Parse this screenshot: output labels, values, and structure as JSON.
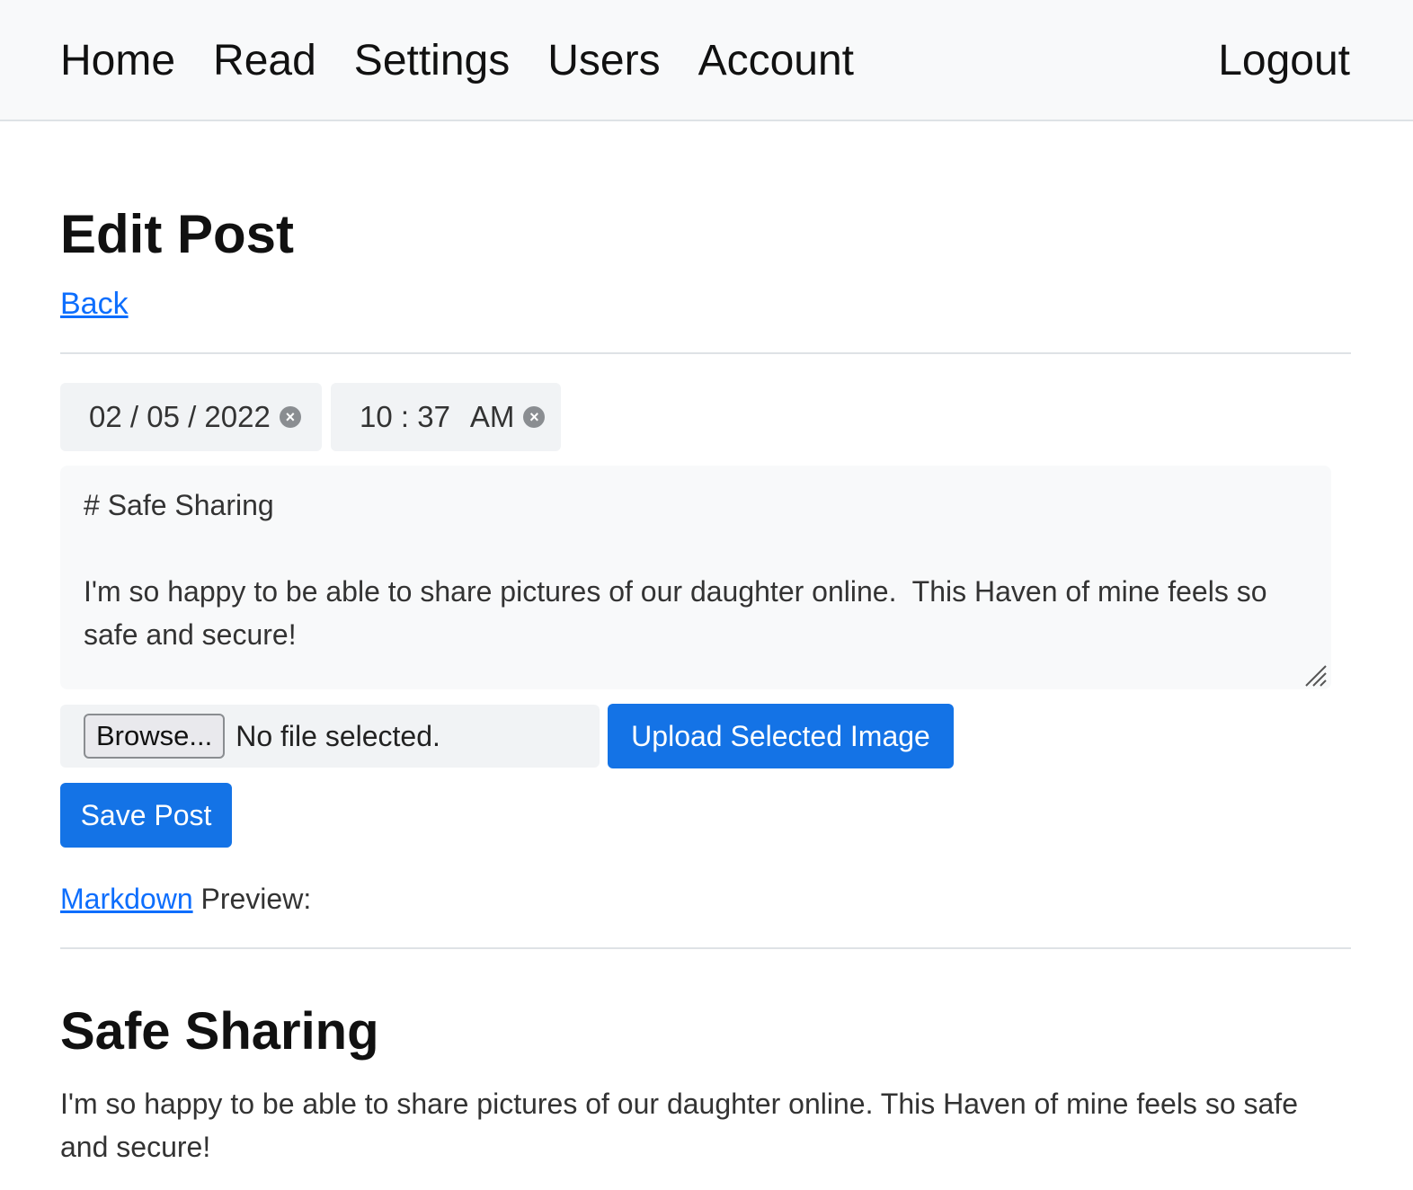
{
  "nav": {
    "items": [
      {
        "label": "Home"
      },
      {
        "label": "Read"
      },
      {
        "label": "Settings"
      },
      {
        "label": "Users"
      },
      {
        "label": "Account"
      }
    ],
    "logout_label": "Logout"
  },
  "page": {
    "title": "Edit Post",
    "back_label": "Back"
  },
  "form": {
    "date_value": "02 / 05 / 2022",
    "time_value": "10 : 37",
    "time_period": "AM",
    "clear_icon": "clear-circle-icon",
    "body_text": "# Safe Sharing\n\nI'm so happy to be able to share pictures of our daughter online.  This Haven of mine feels so safe and secure!",
    "browse_label": "Browse...",
    "file_status": "No file selected.",
    "upload_label": "Upload Selected Image",
    "save_label": "Save Post"
  },
  "preview": {
    "markdown_link": "Markdown",
    "label_suffix": " Preview:",
    "heading": "Safe Sharing",
    "body": "I'm so happy to be able to share pictures of our daughter online. This Haven of mine feels so safe and secure!"
  },
  "colors": {
    "accent": "#1473e6",
    "link": "#0d6efd",
    "navbar_bg": "#f8f9fa"
  }
}
